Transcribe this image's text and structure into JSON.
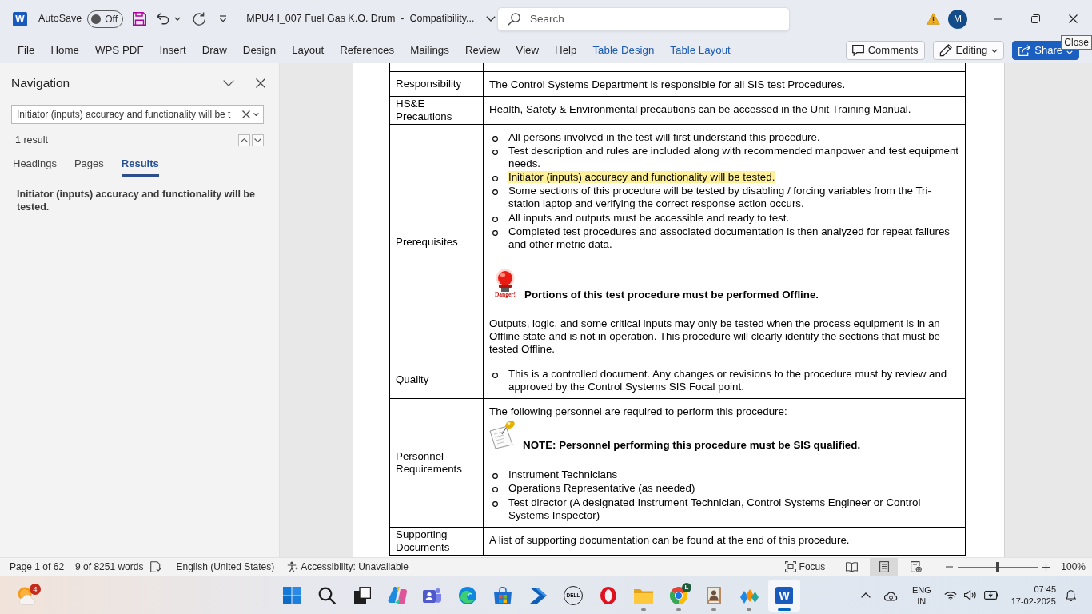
{
  "title_bar": {
    "logo_letter": "W",
    "autosave_label": "AutoSave",
    "autosave": {
      "label": "Off",
      "on": false
    },
    "document_title": "MPU4 I_007 Fuel Gas K.O. Drum  -  Compatibility...",
    "search": {
      "placeholder": "Search"
    },
    "account_initial": "M",
    "tooltip": "Close"
  },
  "ribbon_tabs": [
    {
      "label": "File",
      "kind": "main"
    },
    {
      "label": "Home",
      "kind": "main"
    },
    {
      "label": "WPS PDF",
      "kind": "main"
    },
    {
      "label": "Insert",
      "kind": "main"
    },
    {
      "label": "Draw",
      "kind": "main"
    },
    {
      "label": "Design",
      "kind": "main"
    },
    {
      "label": "Layout",
      "kind": "main"
    },
    {
      "label": "References",
      "kind": "main"
    },
    {
      "label": "Mailings",
      "kind": "main"
    },
    {
      "label": "Review",
      "kind": "main"
    },
    {
      "label": "View",
      "kind": "main"
    },
    {
      "label": "Help",
      "kind": "main"
    },
    {
      "label": "Table Design",
      "kind": "contextual"
    },
    {
      "label": "Table Layout",
      "kind": "contextual"
    }
  ],
  "ribbon_buttons": [
    {
      "kind": "comments",
      "label": "Comments"
    },
    {
      "kind": "editing",
      "label": "Editing"
    },
    {
      "kind": "share",
      "label": "Share"
    }
  ],
  "navigation": {
    "title": "Navigation",
    "search_value": "Initiator (inputs) accuracy and functionality will be t",
    "result_count": "1 result",
    "tabs": [
      {
        "label": "Headings",
        "selected": false
      },
      {
        "label": "Pages",
        "selected": false
      },
      {
        "label": "Results",
        "selected": true
      }
    ],
    "results": [
      "Initiator (inputs) accuracy and functionality will be tested."
    ]
  },
  "document": {
    "rows": [
      {
        "label": "Responsibility",
        "content": [
          {
            "kind": "paragraph",
            "text": "The Control Systems Department is responsible for all SIS test Procedures."
          }
        ]
      },
      {
        "label": "HS&E Precautions",
        "content": [
          {
            "kind": "paragraph",
            "text": "Health, Safety & Environmental precautions can be accessed in the Unit Training Manual."
          }
        ]
      },
      {
        "label": "Prerequisites",
        "content": [
          {
            "kind": "list",
            "items": [
              {
                "text": "All persons involved in the test will first understand this procedure.",
                "highlighted": false
              },
              {
                "text": "Test description and rules are included along with recommended manpower and test equipment needs.",
                "highlighted": false
              },
              {
                "text": "Initiator (inputs) accuracy and functionality will be tested.",
                "highlighted": true
              },
              {
                "text": "Some sections of this procedure will be tested by disabling / forcing variables from the Tri-station laptop and verifying the correct response action occurs.",
                "highlighted": false
              },
              {
                "text": "All inputs and outputs must be accessible and ready to test.",
                "highlighted": false
              },
              {
                "text": "Completed test procedures and associated documentation is then analyzed for repeat failures and other metric data.",
                "highlighted": false
              }
            ]
          },
          {
            "kind": "warning",
            "sign": "Danger!",
            "text": "Portions of this test procedure must be performed Offline."
          },
          {
            "kind": "paragraph",
            "text": "Outputs, logic, and some critical inputs may only be tested when the process equipment is in an Offline state and is not in operation. This procedure will clearly identify the sections that must be tested Offline."
          }
        ]
      },
      {
        "label": "Quality",
        "content": [
          {
            "kind": "list",
            "items": [
              {
                "text": "This is a controlled document. Any changes or revisions to the procedure must by review and approved by the Control Systems SIS Focal point.",
                "highlighted": false
              }
            ]
          }
        ]
      },
      {
        "label": "Personnel Requirements",
        "content": [
          {
            "kind": "paragraph",
            "text": "The following personnel are required to perform this procedure:"
          },
          {
            "kind": "note",
            "text": "NOTE: Personnel performing this procedure must be SIS qualified."
          },
          {
            "kind": "list",
            "items": [
              {
                "text": "Instrument Technicians",
                "highlighted": false
              },
              {
                "text": "Operations Representative (as needed)",
                "highlighted": false
              },
              {
                "text": "Test director (A designated Instrument Technician, Control Systems Engineer or Control Systems Inspector)",
                "highlighted": false
              }
            ]
          }
        ]
      },
      {
        "label": "Supporting Documents",
        "content": [
          {
            "kind": "paragraph",
            "text": "A list of supporting documentation can be found at the end of this procedure."
          }
        ]
      }
    ]
  },
  "status_bar": {
    "page": "Page 1 of 62",
    "words": "9 of 8251 words",
    "language": "English (United States)",
    "accessibility": "Accessibility: Unavailable",
    "focus": "Focus",
    "views": [
      {
        "kind": "read",
        "selected": false
      },
      {
        "kind": "print",
        "selected": true
      },
      {
        "kind": "web",
        "selected": false
      }
    ],
    "zoom": {
      "level": 0.5,
      "reading": "100%"
    }
  },
  "taskbar": {
    "weather": {
      "badge": "4"
    },
    "apps": [
      {
        "kind": "start",
        "running": false,
        "active": false
      },
      {
        "kind": "search",
        "running": false,
        "active": false
      },
      {
        "kind": "taskview",
        "running": false,
        "active": false
      },
      {
        "kind": "copilot",
        "running": false,
        "active": false
      },
      {
        "kind": "teams",
        "running": false,
        "active": false
      },
      {
        "kind": "edge",
        "running": false,
        "active": false
      },
      {
        "kind": "store",
        "running": false,
        "active": false
      },
      {
        "kind": "automate",
        "running": false,
        "active": false
      },
      {
        "kind": "dell",
        "label": "DELL",
        "running": false,
        "active": false
      },
      {
        "kind": "opera",
        "running": false,
        "active": false
      },
      {
        "kind": "files",
        "running": true,
        "active": false
      },
      {
        "kind": "chrome",
        "badge": "L",
        "running": true,
        "active": false
      },
      {
        "kind": "portrait",
        "running": true,
        "active": false
      },
      {
        "kind": "blocks",
        "running": true,
        "active": false
      },
      {
        "kind": "word",
        "label": "W",
        "running": true,
        "active": true
      }
    ],
    "language": {
      "top": "ENG",
      "bottom": "IN"
    },
    "time": "07:45",
    "date": "17-02-2025"
  }
}
